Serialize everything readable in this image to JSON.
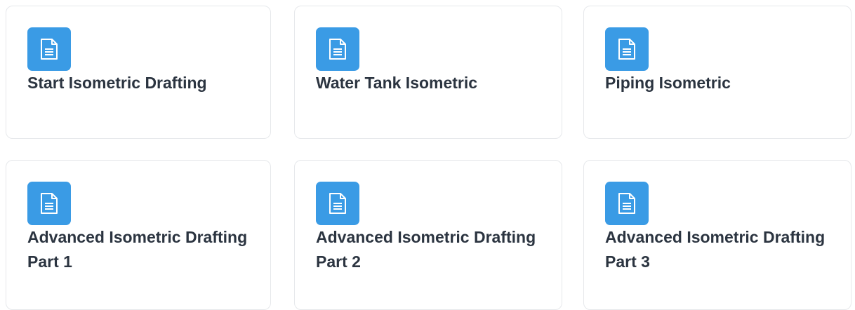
{
  "accent_color": "#3a9be5",
  "cards": [
    {
      "title": "Start Isometric Drafting",
      "icon": "document-icon"
    },
    {
      "title": "Water Tank Isometric",
      "icon": "document-icon"
    },
    {
      "title": "Piping Isometric",
      "icon": "document-icon"
    },
    {
      "title": "Advanced Isometric Drafting Part 1",
      "icon": "document-icon"
    },
    {
      "title": "Advanced Isometric Drafting Part 2",
      "icon": "document-icon"
    },
    {
      "title": "Advanced Isometric Drafting Part 3",
      "icon": "document-icon"
    }
  ]
}
